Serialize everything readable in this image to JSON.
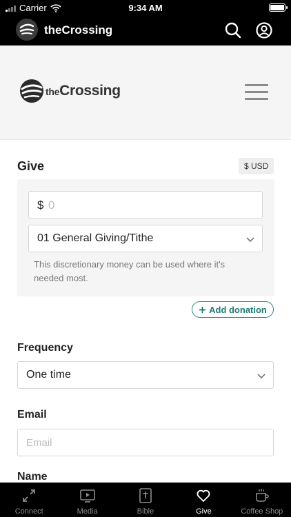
{
  "status_bar": {
    "carrier": "Carrier",
    "time": "9:34 AM"
  },
  "app_header": {
    "title": "theCrossing"
  },
  "site_header": {
    "logo_prefix": "the",
    "logo_name": "Crossing"
  },
  "give_form": {
    "title": "Give",
    "currency": "$ USD",
    "amount_symbol": "$",
    "amount_placeholder": "0",
    "fund_selected": "01 General Giving/Tithe",
    "fund_description": "This discretionary money can be used where it's needed most.",
    "add_donation_label": "Add donation",
    "frequency_label": "Frequency",
    "frequency_selected": "One time",
    "email_label": "Email",
    "email_placeholder": "Email",
    "name_label": "Name"
  },
  "tab_bar": {
    "items": [
      {
        "label": "Connect",
        "icon": "connect-arrows-icon",
        "active": false
      },
      {
        "label": "Media",
        "icon": "play-icon",
        "active": false
      },
      {
        "label": "Bible",
        "icon": "bible-icon",
        "active": false
      },
      {
        "label": "Give",
        "icon": "heart-icon",
        "active": true
      },
      {
        "label": "Coffee Shop",
        "icon": "coffee-cup-icon",
        "active": false
      }
    ]
  },
  "colors": {
    "accent": "#2e8c84",
    "header_bg": "#000000",
    "panel_bg": "#f5f5f5"
  }
}
